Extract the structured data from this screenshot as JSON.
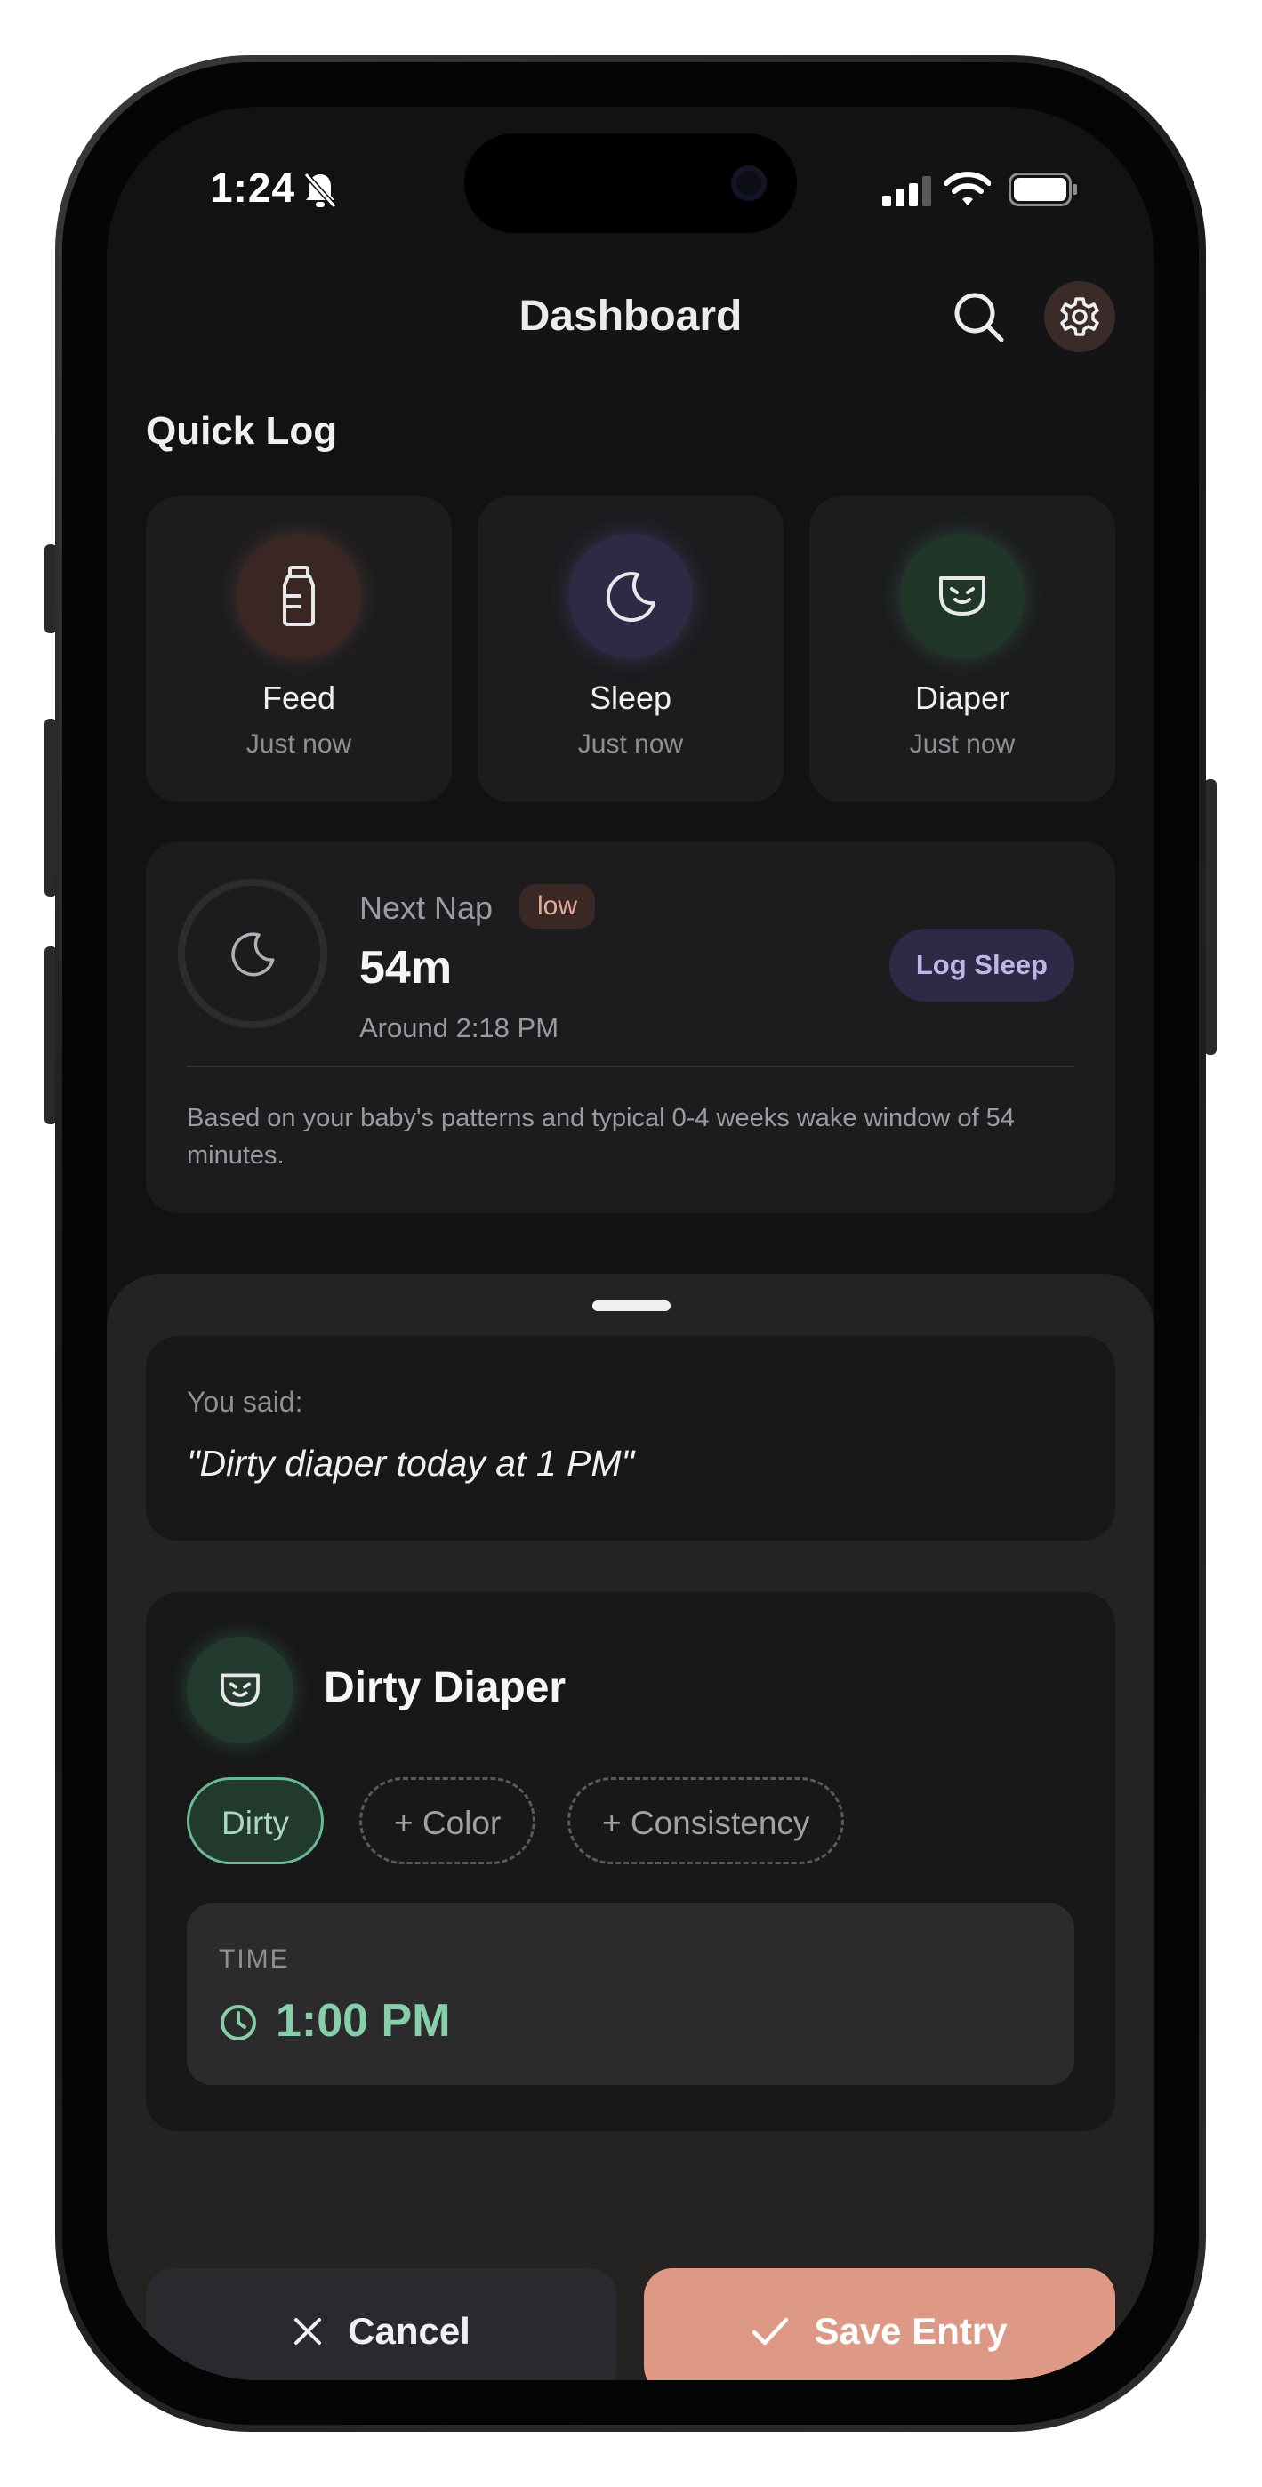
{
  "status_bar": {
    "time": "1:24"
  },
  "header": {
    "title": "Dashboard"
  },
  "quick_log": {
    "title": "Quick Log",
    "items": [
      {
        "name": "Feed",
        "sub": "Just now",
        "icon": "bottle-icon",
        "color": "#3a2723"
      },
      {
        "name": "Sleep",
        "sub": "Just now",
        "icon": "moon-icon",
        "color": "#2c2a45"
      },
      {
        "name": "Diaper",
        "sub": "Just now",
        "icon": "diaper-icon",
        "color": "#203629"
      }
    ]
  },
  "next_nap": {
    "label": "Next Nap",
    "badge": "low",
    "duration": "54m",
    "around": "Around 2:18 PM",
    "button": "Log Sleep",
    "note": "Based on your baby's patterns and typical 0-4 weeks wake window of 54 minutes."
  },
  "sheet": {
    "said_label": "You said:",
    "said_quote": "\"Dirty diaper today at 1 PM\"",
    "entry_title": "Dirty Diaper",
    "chips": [
      "Dirty",
      "+ Color",
      "+ Consistency"
    ],
    "time_label": "TIME",
    "time_value": "1:00 PM",
    "cancel": "Cancel",
    "save": "Save Entry"
  },
  "colors": {
    "accent": "#de9986",
    "mint": "#86cfa8",
    "lavender": "#bdb7e8"
  }
}
